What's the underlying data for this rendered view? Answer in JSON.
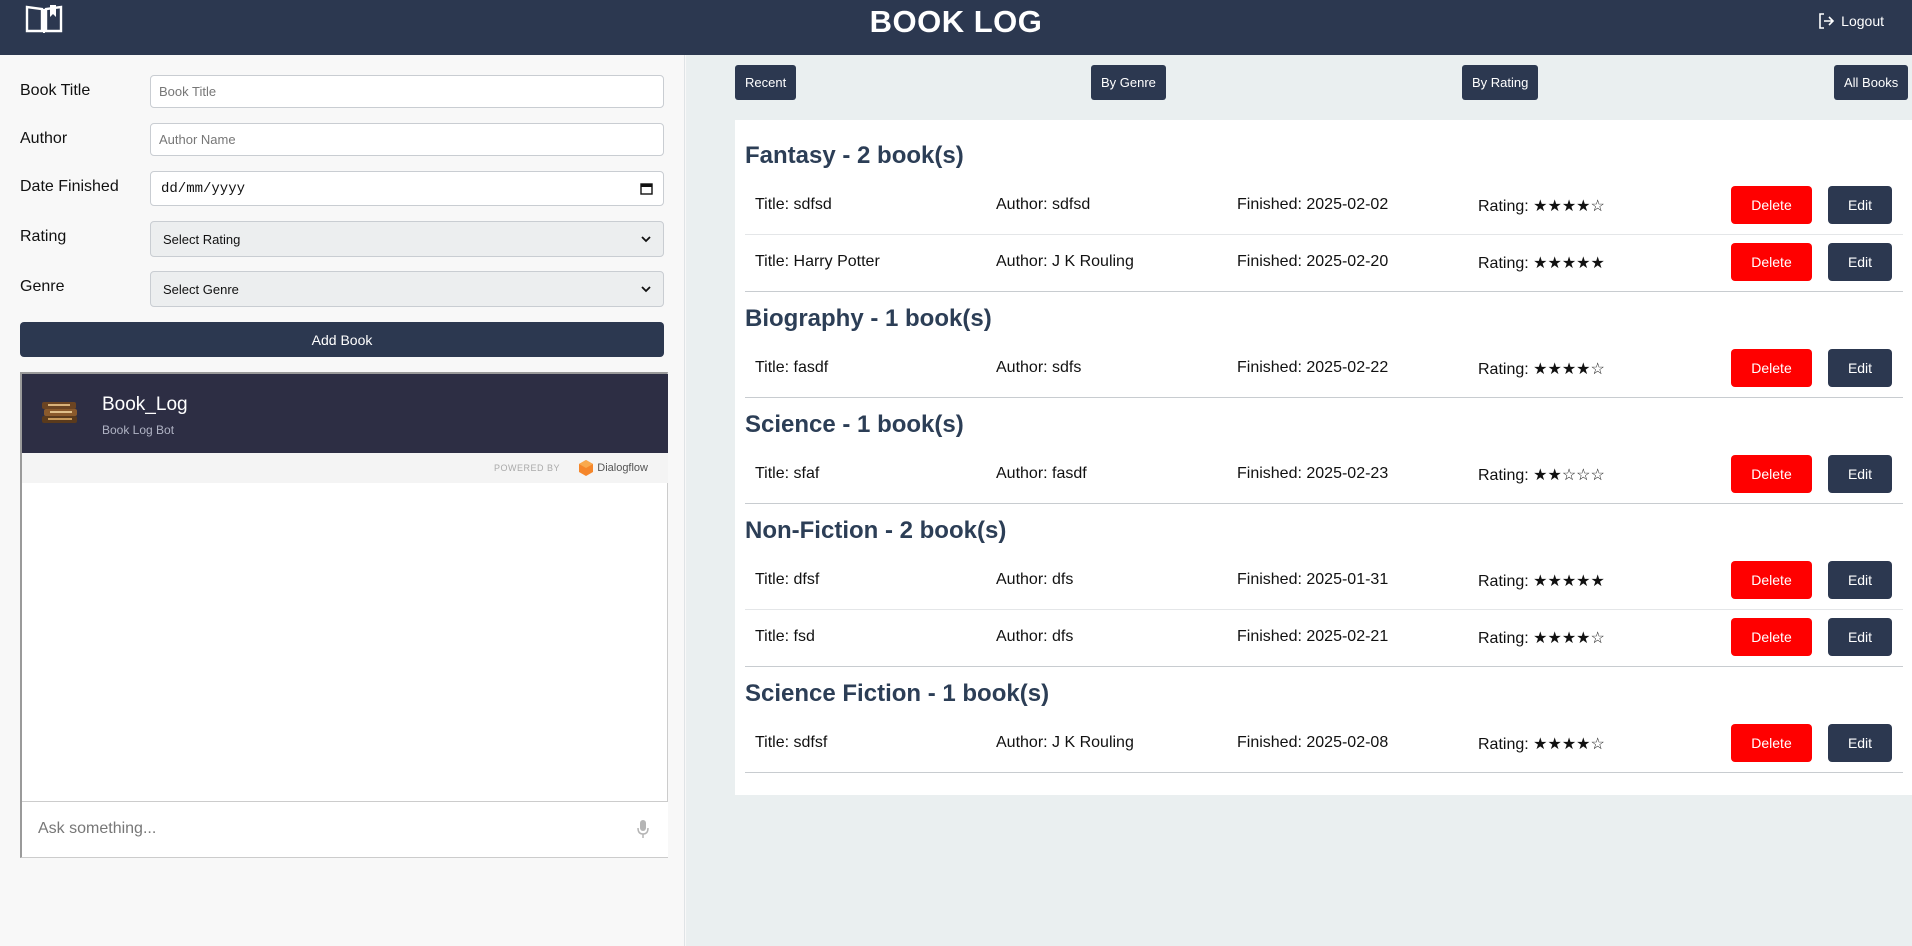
{
  "header": {
    "title": "BOOK LOG",
    "logout_label": "Logout",
    "logo_icon": "open-book-icon"
  },
  "form": {
    "title_label": "Book Title",
    "title_placeholder": "Book Title",
    "author_label": "Author",
    "author_placeholder": "Author Name",
    "date_label": "Date Finished",
    "date_value": "dd/mm/yyyy",
    "rating_label": "Rating",
    "rating_selected": "Select Rating",
    "genre_label": "Genre",
    "genre_selected": "Select Genre",
    "add_button": "Add Book"
  },
  "chat": {
    "bot_name": "Book_Log",
    "bot_subtitle": "Book Log Bot",
    "powered_by": "POWERED BY",
    "provider": "Dialogflow",
    "input_placeholder": "Ask something..."
  },
  "filters": {
    "recent": "Recent",
    "by_genre": "By Genre",
    "by_rating": "By Rating",
    "all_books": "All Books"
  },
  "actions": {
    "delete": "Delete",
    "edit": "Edit"
  },
  "groups": [
    {
      "heading": "Fantasy - 2 book(s)",
      "books": [
        {
          "title": "Title: sdfsd",
          "author": "Author: sdfsd",
          "finished": "Finished: 2025-02-02",
          "rating": "Rating: ★★★★☆"
        },
        {
          "title": "Title: Harry Potter",
          "author": "Author: J K Rouling",
          "finished": "Finished: 2025-02-20",
          "rating": "Rating: ★★★★★"
        }
      ]
    },
    {
      "heading": "Biography - 1 book(s)",
      "books": [
        {
          "title": "Title: fasdf",
          "author": "Author: sdfs",
          "finished": "Finished: 2025-02-22",
          "rating": "Rating: ★★★★☆"
        }
      ]
    },
    {
      "heading": "Science - 1 book(s)",
      "books": [
        {
          "title": "Title: sfaf",
          "author": "Author: fasdf",
          "finished": "Finished: 2025-02-23",
          "rating": "Rating: ★★☆☆☆"
        }
      ]
    },
    {
      "heading": "Non-Fiction - 2 book(s)",
      "books": [
        {
          "title": "Title: dfsf",
          "author": "Author: dfs",
          "finished": "Finished: 2025-01-31",
          "rating": "Rating: ★★★★★"
        },
        {
          "title": "Title: fsd",
          "author": "Author: dfs",
          "finished": "Finished: 2025-02-21",
          "rating": "Rating: ★★★★☆"
        }
      ]
    },
    {
      "heading": "Science Fiction - 1 book(s)",
      "books": [
        {
          "title": "Title: sdfsf",
          "author": "Author: J K Rouling",
          "finished": "Finished: 2025-02-08",
          "rating": "Rating: ★★★★☆"
        }
      ]
    }
  ]
}
